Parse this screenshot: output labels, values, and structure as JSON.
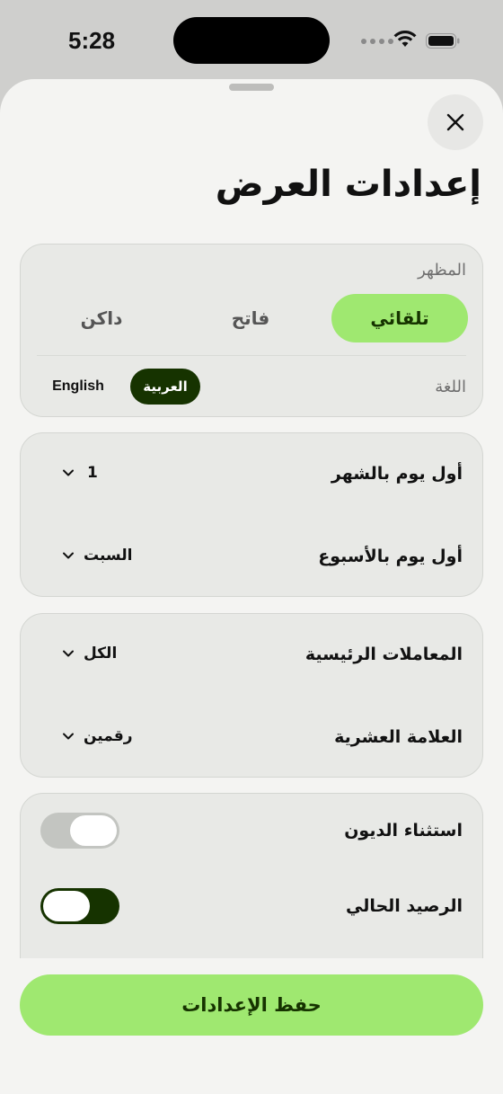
{
  "status_bar": {
    "time": "5:28"
  },
  "sheet": {
    "title": "إعدادات العرض",
    "appearance": {
      "label": "المظهر",
      "options": [
        "تلقائي",
        "فاتح",
        "داكن"
      ],
      "selected": "تلقائي"
    },
    "language": {
      "label": "اللغة",
      "options": [
        "العربية",
        "English"
      ],
      "selected": "العربية"
    },
    "calendar": {
      "first_day_month_label": "أول يوم بالشهر",
      "first_day_month_value": "1",
      "first_day_week_label": "أول يوم بالأسبوع",
      "first_day_week_value": "السبت"
    },
    "transactions": {
      "main_transactions_label": "المعاملات الرئيسية",
      "main_transactions_value": "الكل",
      "decimal_mark_label": "العلامة العشرية",
      "decimal_mark_value": "رقمين"
    },
    "toggles": {
      "exclude_debts_label": "استثناء الديون",
      "exclude_debts_on": false,
      "current_balance_label": "الرصيد الحالي",
      "current_balance_on": true
    },
    "save_label": "حفظ الإعدادات"
  },
  "colors": {
    "accent_green": "#9fe870",
    "dark_green": "#163300",
    "sheet_bg": "#f4f4f2",
    "card_bg": "#e8e9e6"
  }
}
